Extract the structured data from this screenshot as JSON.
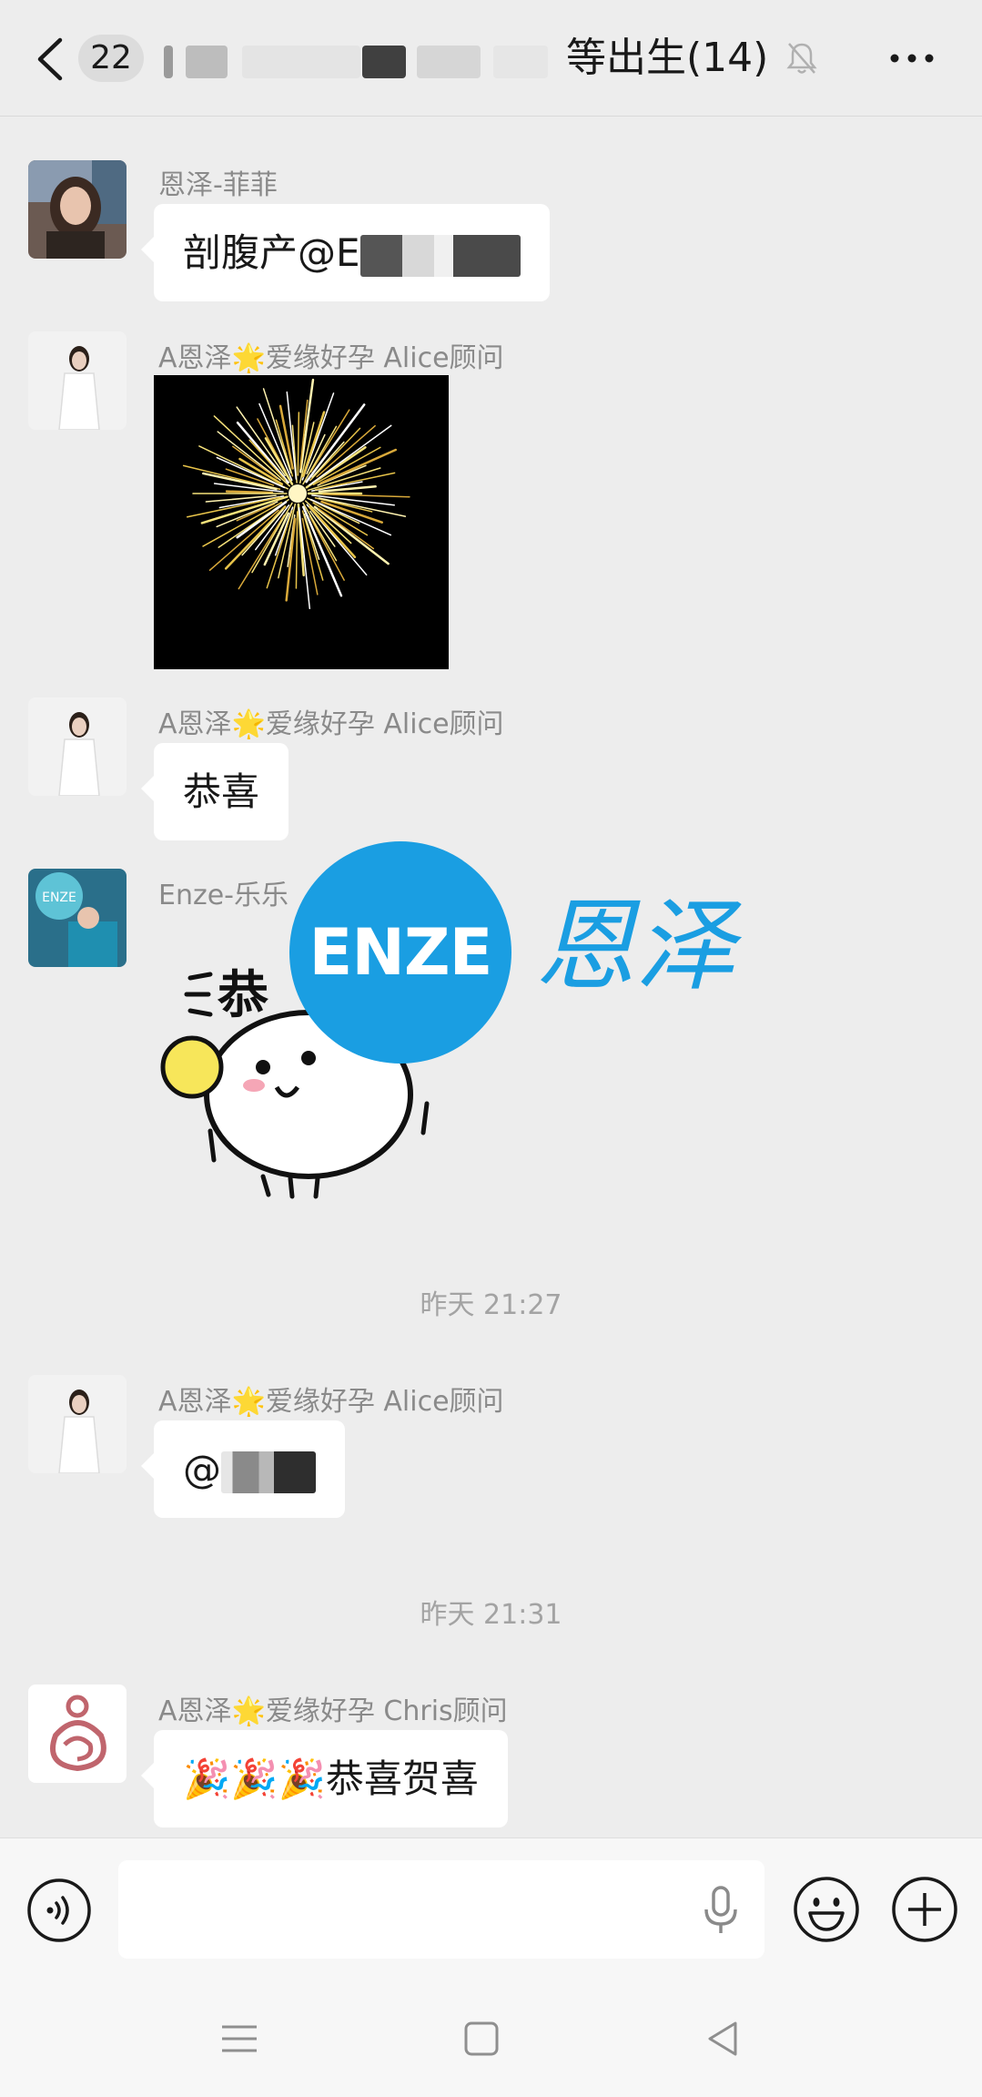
{
  "header": {
    "unread_count": "22",
    "title_visible": "等出生(14)"
  },
  "messages": [
    {
      "sender": "恩泽-菲菲",
      "text": "剖腹产@E"
    },
    {
      "sender": "A恩泽🌟爱缘好孕 Alice顾问"
    },
    {
      "sender": "A恩泽🌟爱缘好孕 Alice顾问",
      "text": "恭喜"
    },
    {
      "sender": "Enze-乐乐",
      "sticker_text": "恭"
    },
    {
      "sender": "A恩泽🌟爱缘好孕 Alice顾问",
      "text": "@"
    },
    {
      "sender": "A恩泽🌟爱缘好孕 Chris顾问",
      "text": "🎉🎉🎉恭喜贺喜"
    }
  ],
  "timestamps": [
    "昨天 21:27",
    "昨天 21:31"
  ],
  "watermark": {
    "logo_text": "ENZE",
    "brand_text": "恩泽",
    "color": "#1a9ee2"
  },
  "avatar_badge": "ENZE",
  "input": {
    "placeholder": "",
    "value": ""
  },
  "icons": {
    "back": "chevron-left-icon",
    "mute": "bell-off-icon",
    "more": "more-dots-icon",
    "voice": "voice-wave-icon",
    "mic": "microphone-icon",
    "emoji": "smiley-icon",
    "plus": "plus-circle-icon",
    "nav_menu": "menu-lines-icon",
    "nav_home": "square-icon",
    "nav_back": "triangle-back-icon"
  }
}
